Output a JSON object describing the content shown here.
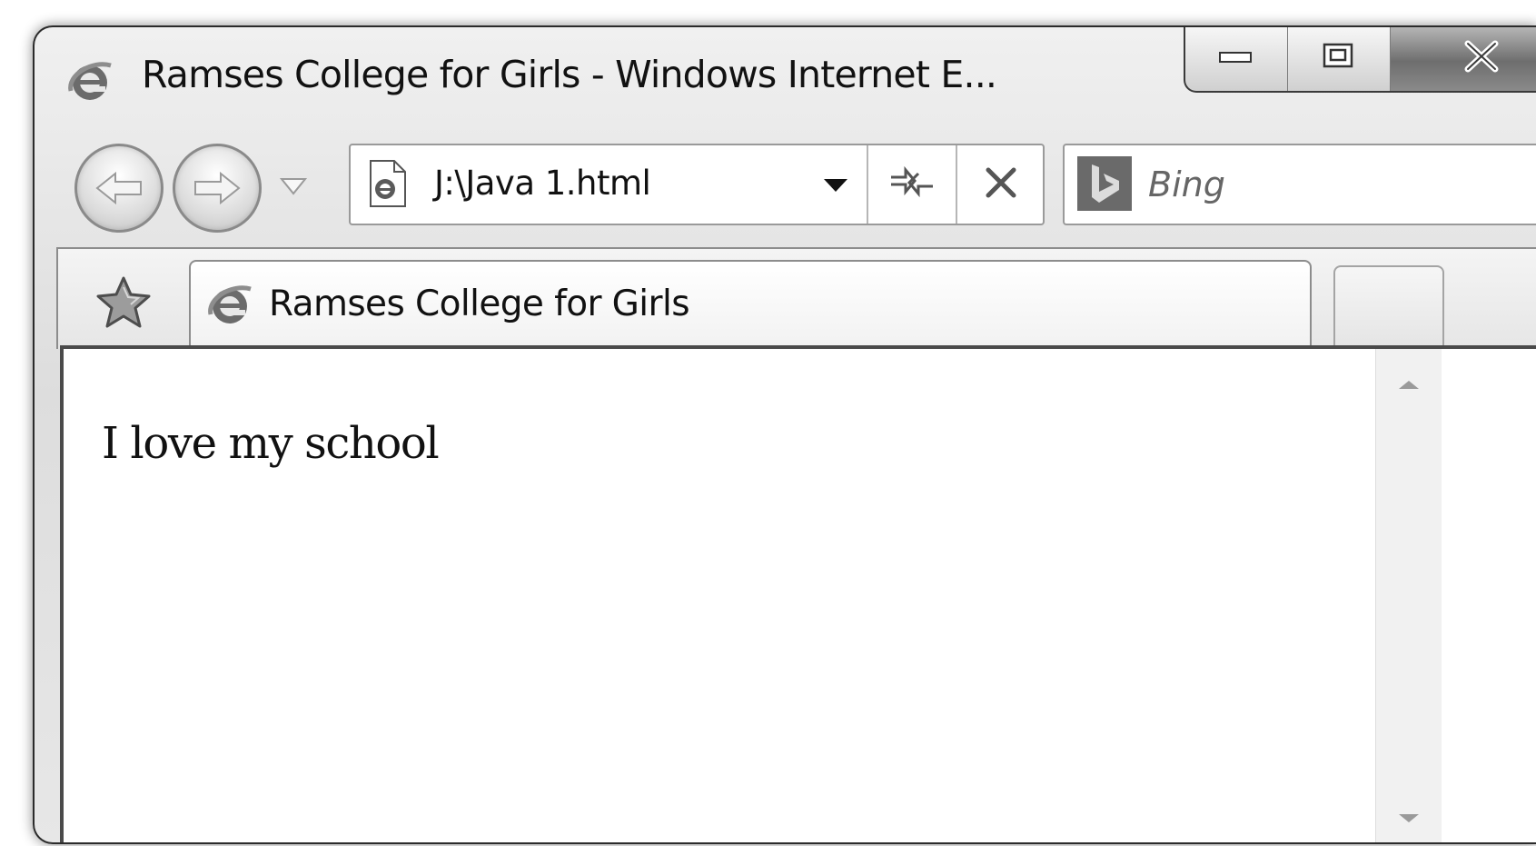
{
  "window": {
    "title": "Ramses College for Girls - Windows Internet E..."
  },
  "navigation": {
    "address": "J:\\Java 1.html",
    "search_placeholder": "Bing"
  },
  "tabs": [
    {
      "label": "Ramses College for Girls",
      "active": true
    }
  ],
  "content": {
    "body_text": "I love my school"
  },
  "icons": {
    "browser": "internet-explorer-icon",
    "favorites": "star-icon",
    "search_provider": "bing-icon"
  }
}
